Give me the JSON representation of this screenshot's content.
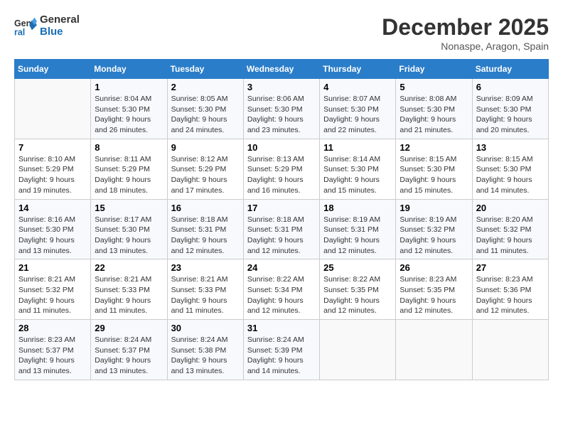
{
  "logo": {
    "line1": "General",
    "line2": "Blue"
  },
  "title": "December 2025",
  "location": "Nonaspe, Aragon, Spain",
  "weekdays": [
    "Sunday",
    "Monday",
    "Tuesday",
    "Wednesday",
    "Thursday",
    "Friday",
    "Saturday"
  ],
  "weeks": [
    [
      {
        "day": "",
        "sunrise": "",
        "sunset": "",
        "daylight": ""
      },
      {
        "day": "1",
        "sunrise": "Sunrise: 8:04 AM",
        "sunset": "Sunset: 5:30 PM",
        "daylight": "Daylight: 9 hours and 26 minutes."
      },
      {
        "day": "2",
        "sunrise": "Sunrise: 8:05 AM",
        "sunset": "Sunset: 5:30 PM",
        "daylight": "Daylight: 9 hours and 24 minutes."
      },
      {
        "day": "3",
        "sunrise": "Sunrise: 8:06 AM",
        "sunset": "Sunset: 5:30 PM",
        "daylight": "Daylight: 9 hours and 23 minutes."
      },
      {
        "day": "4",
        "sunrise": "Sunrise: 8:07 AM",
        "sunset": "Sunset: 5:30 PM",
        "daylight": "Daylight: 9 hours and 22 minutes."
      },
      {
        "day": "5",
        "sunrise": "Sunrise: 8:08 AM",
        "sunset": "Sunset: 5:30 PM",
        "daylight": "Daylight: 9 hours and 21 minutes."
      },
      {
        "day": "6",
        "sunrise": "Sunrise: 8:09 AM",
        "sunset": "Sunset: 5:30 PM",
        "daylight": "Daylight: 9 hours and 20 minutes."
      }
    ],
    [
      {
        "day": "7",
        "sunrise": "Sunrise: 8:10 AM",
        "sunset": "Sunset: 5:29 PM",
        "daylight": "Daylight: 9 hours and 19 minutes."
      },
      {
        "day": "8",
        "sunrise": "Sunrise: 8:11 AM",
        "sunset": "Sunset: 5:29 PM",
        "daylight": "Daylight: 9 hours and 18 minutes."
      },
      {
        "day": "9",
        "sunrise": "Sunrise: 8:12 AM",
        "sunset": "Sunset: 5:29 PM",
        "daylight": "Daylight: 9 hours and 17 minutes."
      },
      {
        "day": "10",
        "sunrise": "Sunrise: 8:13 AM",
        "sunset": "Sunset: 5:29 PM",
        "daylight": "Daylight: 9 hours and 16 minutes."
      },
      {
        "day": "11",
        "sunrise": "Sunrise: 8:14 AM",
        "sunset": "Sunset: 5:30 PM",
        "daylight": "Daylight: 9 hours and 15 minutes."
      },
      {
        "day": "12",
        "sunrise": "Sunrise: 8:15 AM",
        "sunset": "Sunset: 5:30 PM",
        "daylight": "Daylight: 9 hours and 15 minutes."
      },
      {
        "day": "13",
        "sunrise": "Sunrise: 8:15 AM",
        "sunset": "Sunset: 5:30 PM",
        "daylight": "Daylight: 9 hours and 14 minutes."
      }
    ],
    [
      {
        "day": "14",
        "sunrise": "Sunrise: 8:16 AM",
        "sunset": "Sunset: 5:30 PM",
        "daylight": "Daylight: 9 hours and 13 minutes."
      },
      {
        "day": "15",
        "sunrise": "Sunrise: 8:17 AM",
        "sunset": "Sunset: 5:30 PM",
        "daylight": "Daylight: 9 hours and 13 minutes."
      },
      {
        "day": "16",
        "sunrise": "Sunrise: 8:18 AM",
        "sunset": "Sunset: 5:31 PM",
        "daylight": "Daylight: 9 hours and 12 minutes."
      },
      {
        "day": "17",
        "sunrise": "Sunrise: 8:18 AM",
        "sunset": "Sunset: 5:31 PM",
        "daylight": "Daylight: 9 hours and 12 minutes."
      },
      {
        "day": "18",
        "sunrise": "Sunrise: 8:19 AM",
        "sunset": "Sunset: 5:31 PM",
        "daylight": "Daylight: 9 hours and 12 minutes."
      },
      {
        "day": "19",
        "sunrise": "Sunrise: 8:19 AM",
        "sunset": "Sunset: 5:32 PM",
        "daylight": "Daylight: 9 hours and 12 minutes."
      },
      {
        "day": "20",
        "sunrise": "Sunrise: 8:20 AM",
        "sunset": "Sunset: 5:32 PM",
        "daylight": "Daylight: 9 hours and 11 minutes."
      }
    ],
    [
      {
        "day": "21",
        "sunrise": "Sunrise: 8:21 AM",
        "sunset": "Sunset: 5:32 PM",
        "daylight": "Daylight: 9 hours and 11 minutes."
      },
      {
        "day": "22",
        "sunrise": "Sunrise: 8:21 AM",
        "sunset": "Sunset: 5:33 PM",
        "daylight": "Daylight: 9 hours and 11 minutes."
      },
      {
        "day": "23",
        "sunrise": "Sunrise: 8:21 AM",
        "sunset": "Sunset: 5:33 PM",
        "daylight": "Daylight: 9 hours and 11 minutes."
      },
      {
        "day": "24",
        "sunrise": "Sunrise: 8:22 AM",
        "sunset": "Sunset: 5:34 PM",
        "daylight": "Daylight: 9 hours and 12 minutes."
      },
      {
        "day": "25",
        "sunrise": "Sunrise: 8:22 AM",
        "sunset": "Sunset: 5:35 PM",
        "daylight": "Daylight: 9 hours and 12 minutes."
      },
      {
        "day": "26",
        "sunrise": "Sunrise: 8:23 AM",
        "sunset": "Sunset: 5:35 PM",
        "daylight": "Daylight: 9 hours and 12 minutes."
      },
      {
        "day": "27",
        "sunrise": "Sunrise: 8:23 AM",
        "sunset": "Sunset: 5:36 PM",
        "daylight": "Daylight: 9 hours and 12 minutes."
      }
    ],
    [
      {
        "day": "28",
        "sunrise": "Sunrise: 8:23 AM",
        "sunset": "Sunset: 5:37 PM",
        "daylight": "Daylight: 9 hours and 13 minutes."
      },
      {
        "day": "29",
        "sunrise": "Sunrise: 8:24 AM",
        "sunset": "Sunset: 5:37 PM",
        "daylight": "Daylight: 9 hours and 13 minutes."
      },
      {
        "day": "30",
        "sunrise": "Sunrise: 8:24 AM",
        "sunset": "Sunset: 5:38 PM",
        "daylight": "Daylight: 9 hours and 13 minutes."
      },
      {
        "day": "31",
        "sunrise": "Sunrise: 8:24 AM",
        "sunset": "Sunset: 5:39 PM",
        "daylight": "Daylight: 9 hours and 14 minutes."
      },
      {
        "day": "",
        "sunrise": "",
        "sunset": "",
        "daylight": ""
      },
      {
        "day": "",
        "sunrise": "",
        "sunset": "",
        "daylight": ""
      },
      {
        "day": "",
        "sunrise": "",
        "sunset": "",
        "daylight": ""
      }
    ]
  ]
}
